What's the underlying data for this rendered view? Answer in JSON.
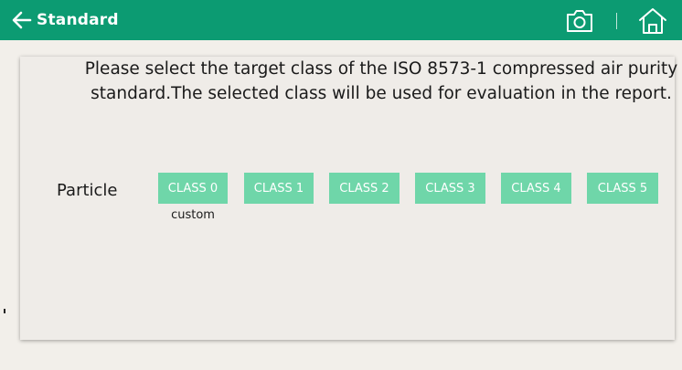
{
  "header": {
    "title": "Standard",
    "back_icon": "arrow-left-icon",
    "camera_icon": "camera-icon",
    "home_icon": "home-icon",
    "background_color": "#0c9b72"
  },
  "panel": {
    "message": "Please select the target class of the ISO 8573-1 compressed air purity standard.The selected class will be used for evaluation in the report.",
    "particle_label": "Particle",
    "classes": [
      "CLASS 0",
      "CLASS 1",
      "CLASS 2",
      "CLASS 3",
      "CLASS 4",
      "CLASS 5"
    ],
    "class0_sub_label": "custom",
    "button_color": "#6fd6a9"
  }
}
